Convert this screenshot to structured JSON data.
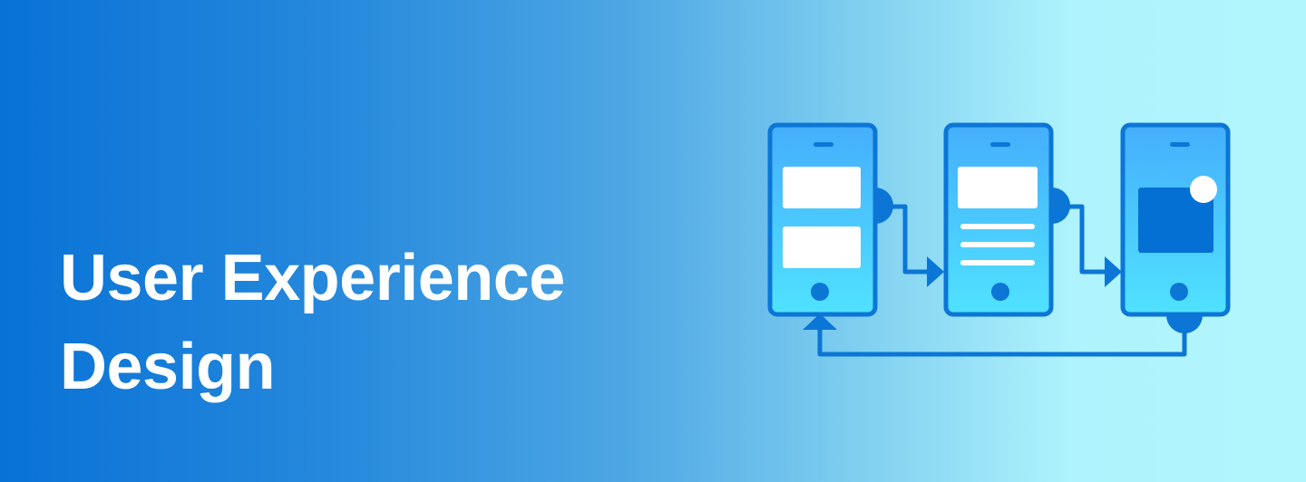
{
  "banner": {
    "title_line1": "User Experience",
    "title_line2": "Design"
  },
  "illustration": {
    "icon": "ux-flow-wireframe-icon",
    "screens": [
      "form-screen",
      "list-screen",
      "media-screen"
    ]
  },
  "colors": {
    "gradient_start": "#0872d6",
    "gradient_end": "#b2f6fd",
    "text": "#ffffff",
    "outline": "#0c76d6",
    "screen_top": "#45aefc",
    "screen_bottom": "#50e2ff",
    "accent": "#0570d3"
  }
}
